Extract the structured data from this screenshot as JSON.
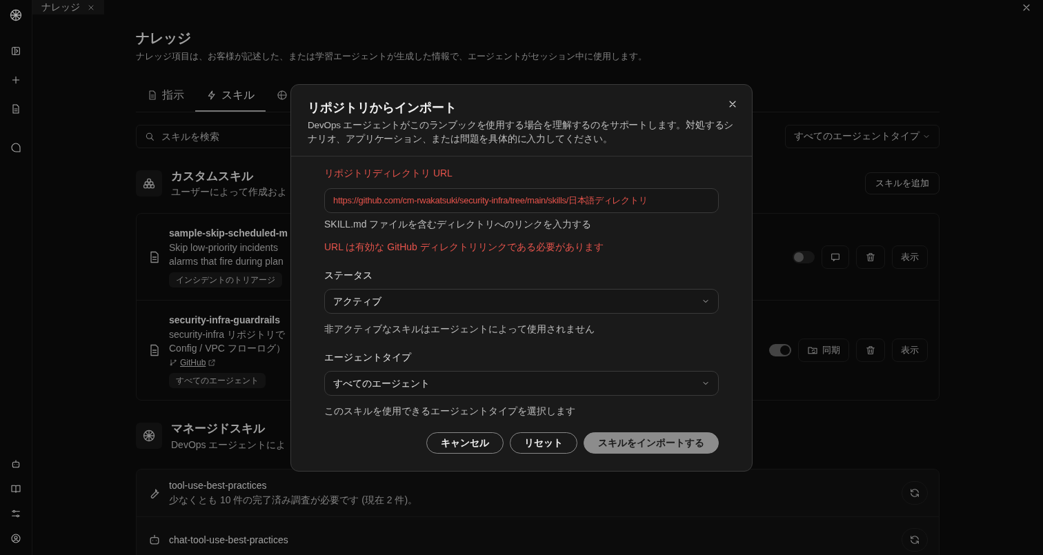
{
  "window_tabs": [
    {
      "label": "ナレッジ",
      "selected": true
    }
  ],
  "page": {
    "title": "ナレッジ",
    "description": "ナレッジ項目は、お客様が記述した、または学習エージェントが生成した情報で、エージェントがセッション中に使用します。"
  },
  "tabs": [
    {
      "label": "指示",
      "kind": "doc",
      "selected": false
    },
    {
      "label": "スキル",
      "kind": "bolt",
      "selected": true
    },
    {
      "kind": "globe",
      "selected": false
    }
  ],
  "search": {
    "placeholder": "スキルを検索"
  },
  "agent_filter": {
    "value": "すべてのエージェントタイプ"
  },
  "custom_skills": {
    "title": "カスタムスキル",
    "description": "ユーザーによって作成およ",
    "add_button": "スキルを追加",
    "items": [
      {
        "kind": "manual",
        "name": "sample-skip-scheduled-m",
        "description": [
          "Skip low-priority incidents",
          "alarms that fire during plan"
        ],
        "tag": "インシデントのトリアージ",
        "enabled": false,
        "view_button": "表示"
      },
      {
        "kind": "github",
        "name": "security-infra-guardrails",
        "description": [
          "security-infra リポジトリで",
          "Config / VPC フローログ）"
        ],
        "source_link": "GitHub",
        "tag": "すべてのエージェント",
        "enabled": true,
        "sync_button": "同期",
        "view_button": "表示"
      }
    ]
  },
  "managed_skills": {
    "title": "マネージドスキル",
    "description": "DevOps エージェントによ",
    "items": [
      {
        "name": "tool-use-best-practices",
        "description": "少なくとも 10 件の完了済み調査が必要です (現在 2 件)。"
      },
      {
        "name": "chat-tool-use-best-practices"
      }
    ]
  },
  "dialog": {
    "title": "リポジトリからインポート",
    "description": "DevOps エージェントがこのランブックを使用する場合を理解するのをサポートします。対処するシナリオ、アプリケーション、または問題を具体的に入力してください。",
    "url_field": {
      "label": "リポジトリディレクトリ URL",
      "value": "https://github.com/cm-rwakatsuki/security-infra/tree/main/skills/日本語ディレクトリ",
      "invalid": true,
      "help": "SKILL.md ファイルを含むディレクトリへのリンクを入力する",
      "error": "URL は有効な GitHub ディレクトリリンクである必要があります"
    },
    "status_field": {
      "label": "ステータス",
      "value": "アクティブ",
      "help": "非アクティブなスキルはエージェントによって使用されません"
    },
    "agent_field": {
      "label": "エージェントタイプ",
      "value": "すべてのエージェント",
      "help": "このスキルを使用できるエージェントタイプを選択します"
    },
    "buttons": [
      {
        "label": "キャンセル",
        "kind": "secondary"
      },
      {
        "label": "リセット",
        "kind": "secondary"
      },
      {
        "label": "スキルをインポートする",
        "kind": "primary"
      }
    ]
  }
}
